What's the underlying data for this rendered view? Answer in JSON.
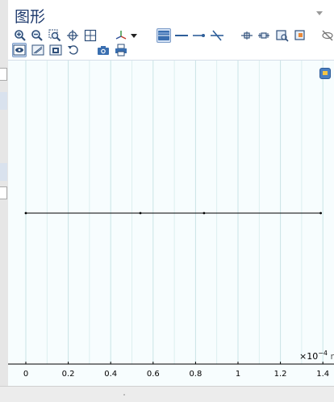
{
  "window": {
    "title": "图形"
  },
  "toolbar": {
    "row1": [
      {
        "icon": "zoom-in-icon"
      },
      {
        "icon": "zoom-out-icon"
      },
      {
        "icon": "zoom-box-icon"
      },
      {
        "icon": "pan-icon"
      },
      {
        "icon": "zoom-extents-icon"
      },
      {
        "icon": "axis-orientation-icon"
      },
      {
        "icon": "dropdown-arrow-icon"
      },
      {
        "icon": "select-domains-icon"
      },
      {
        "icon": "select-boundaries-icon"
      },
      {
        "icon": "select-edges-icon"
      },
      {
        "icon": "select-points-icon"
      },
      {
        "icon": "selection-mode-icon"
      },
      {
        "icon": "deselect-icon"
      },
      {
        "icon": "show-selection-icon"
      },
      {
        "icon": "hide-icon"
      }
    ],
    "row2": [
      {
        "icon": "view-icon",
        "active": true
      },
      {
        "icon": "grid-view-icon"
      },
      {
        "icon": "scene-light-icon"
      },
      {
        "icon": "reset-view-icon"
      },
      {
        "icon": "screenshot-icon"
      },
      {
        "icon": "print-icon"
      }
    ]
  },
  "plot": {
    "x_tick_labels": [
      "0",
      "0.2",
      "0.4",
      "0.6",
      "0.8",
      "1",
      "1.2",
      "1.4"
    ],
    "x_ticks": [
      0,
      0.2,
      0.4,
      0.6,
      0.8,
      1.0,
      1.2,
      1.4
    ],
    "minor_grid": [
      0.1,
      0.3,
      0.5,
      0.7,
      0.9,
      1.1,
      1.3
    ],
    "exponent_prefix": "×10",
    "exponent_power": "−4",
    "unit": "m",
    "colors": {
      "background": "#f7fdfe",
      "grid": "#d6ecec",
      "geometry": "#000000",
      "title": "#1f3b6e"
    },
    "geometry": {
      "type": "1D line",
      "vertices_x": [
        0,
        0.54,
        0.84,
        1.39
      ]
    }
  }
}
